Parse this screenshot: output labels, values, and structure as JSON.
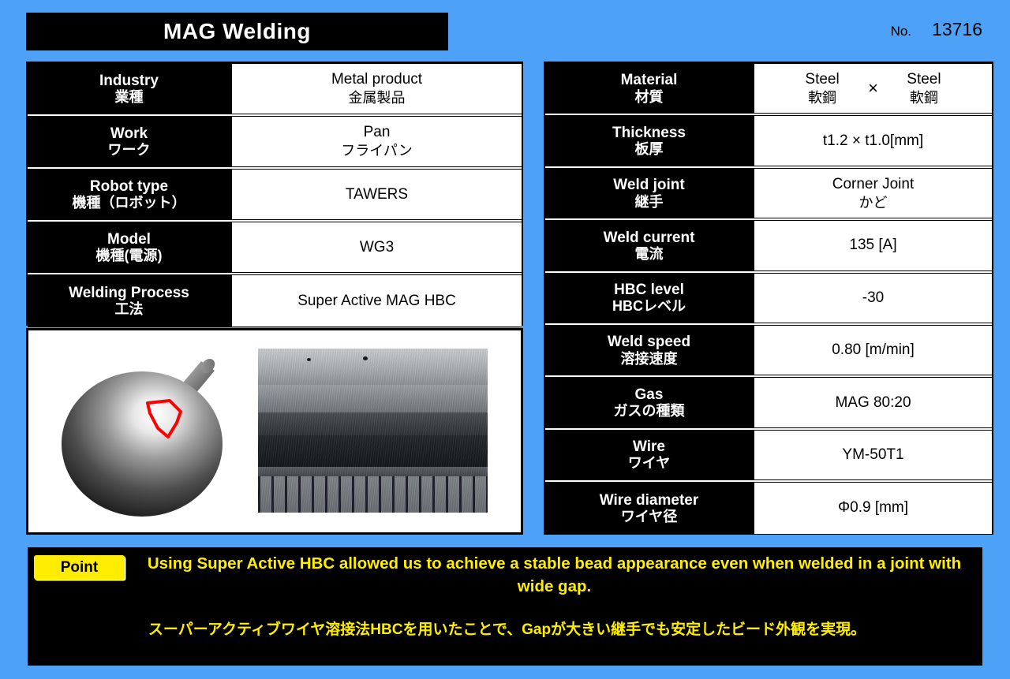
{
  "header": {
    "title": "MAG Welding",
    "no_label": "No.",
    "no_value": "13716"
  },
  "left_table": [
    {
      "en": "Industry",
      "ja": "業種",
      "value_en": "Metal product",
      "value_ja": "金属製品"
    },
    {
      "en": "Work",
      "ja": "ワーク",
      "value_en": "Pan",
      "value_ja": "フライパン"
    },
    {
      "en": "Robot type",
      "ja": "機種（ロボット）",
      "value_en": "TAWERS",
      "value_ja": ""
    },
    {
      "en": "Model",
      "ja": "機種(電源)",
      "value_en": "WG3",
      "value_ja": ""
    },
    {
      "en": "Welding Process",
      "ja": "工法",
      "value_en": "Super Active MAG HBC",
      "value_ja": ""
    }
  ],
  "right_table": {
    "material": {
      "en": "Material",
      "ja": "材質",
      "left_en": "Steel",
      "left_ja": "軟鋼",
      "separator": "×",
      "right_en": "Steel",
      "right_ja": "軟鋼"
    },
    "rows": [
      {
        "en": "Thickness",
        "ja": "板厚",
        "value_en": "t1.2 × t1.0[mm]",
        "value_ja": ""
      },
      {
        "en": "Weld joint",
        "ja": "継手",
        "value_en": "Corner Joint",
        "value_ja": "かど"
      },
      {
        "en": "Weld current",
        "ja": "電流",
        "value_en": "135 [A]",
        "value_ja": ""
      },
      {
        "en": "HBC level",
        "ja": "HBCレベル",
        "value_en": "-30",
        "value_ja": ""
      },
      {
        "en": "Weld speed",
        "ja": "溶接速度",
        "value_en": "0.80 [m/min]",
        "value_ja": ""
      },
      {
        "en": "Gas",
        "ja": "ガスの種類",
        "value_en": "MAG 80:20",
        "value_ja": ""
      },
      {
        "en": "Wire",
        "ja": "ワイヤ",
        "value_en": "YM-50T1",
        "value_ja": ""
      },
      {
        "en": "Wire diameter",
        "ja": "ワイヤ径",
        "value_en": "Φ0.9 [mm]",
        "value_ja": ""
      }
    ]
  },
  "figures": {
    "diagram_name": "pan-weld-joint-diagram",
    "photo_name": "weld-bead-macro-photo",
    "highlight_color": "#ff0000"
  },
  "point": {
    "badge": "Point",
    "text_en": "Using Super Active HBC allowed us to achieve a stable bead appearance even when welded in a joint with wide gap.",
    "text_ja": "スーパーアクティブワイヤ溶接法HBCを用いたことで、Gapが大きい継手でも安定したビード外観を実現。"
  },
  "colors": {
    "background": "#4da2f7",
    "panel": "#000000",
    "accent_yellow": "#ffec00"
  }
}
